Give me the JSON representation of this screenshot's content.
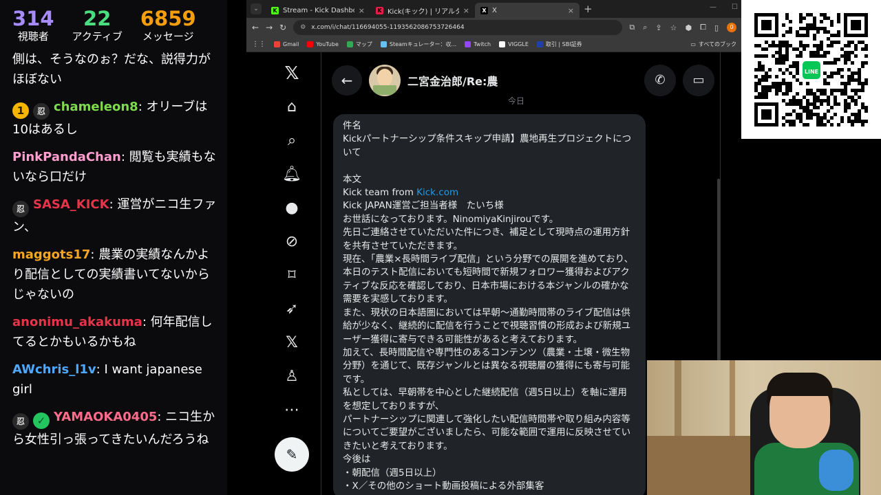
{
  "stream": {
    "stats": [
      {
        "value": "314",
        "label": "視聴者",
        "color": "#a78bfa"
      },
      {
        "value": "22",
        "label": "アクティブ",
        "color": "#4ade80"
      },
      {
        "value": "6859",
        "label": "メッセージ",
        "color": "#f59e0b"
      }
    ],
    "messages": [
      {
        "user": "",
        "text": "側は、そうなのぉ？だな、説得力がほぼない",
        "user_color": "#ffffff",
        "badges": []
      },
      {
        "user": "chameleon8",
        "text": "オリーブは10はあるし",
        "user_color": "#7ddc4e",
        "badges": [
          "1",
          "ninja"
        ]
      },
      {
        "user": "PinkPandaChan",
        "text": "閲覧も実績もないなら口だけ",
        "user_color": "#ff9ecf",
        "badges": []
      },
      {
        "user": "SASA_KICK",
        "text": "運営がニコ生ファン、",
        "user_color": "#e8344a",
        "badges": [
          "ninja"
        ]
      },
      {
        "user": "maggots17",
        "text": "農業の実績なんかより配信としての実績書いてないからじゃないの",
        "user_color": "#f5a524",
        "badges": []
      },
      {
        "user": "anonimu_akakuma",
        "text": "何年配信してるとかもいるかもね",
        "user_color": "#e8344a",
        "badges": []
      },
      {
        "user": "AWchris_l1v",
        "text": "I want japanese girl",
        "user_color": "#4ea8ff",
        "badges": []
      },
      {
        "user": "YAMAOKA0405",
        "text": "ニコ生から女性引っ張ってきたいんだろうね",
        "user_color": "#ff6b8a",
        "badges": [
          "ninja",
          "verified"
        ]
      }
    ]
  },
  "browser": {
    "tabs": [
      {
        "title": "Stream - Kick Dashboard",
        "fav_color": "#53fc18",
        "fav_text": "K",
        "active": false
      },
      {
        "title": "Kick(キック) | リアルタイムランキング",
        "fav_color": "#e11d48",
        "fav_text": "K",
        "active": false
      },
      {
        "title": "X",
        "fav_color": "#000000",
        "fav_text": "X",
        "active": true
      }
    ],
    "url": "x.com/i/chat/116694055-1193562086753726464",
    "bookmarks": [
      {
        "label": "Gmail",
        "color": "#ea4335"
      },
      {
        "label": "YouTube",
        "color": "#ff0000"
      },
      {
        "label": "マップ",
        "color": "#34a853"
      },
      {
        "label": "Steamキュレーター：収...",
        "color": "#66c0f4"
      },
      {
        "label": "Twitch",
        "color": "#9146ff"
      },
      {
        "label": "VIGGLE",
        "color": "#ffffff"
      },
      {
        "label": "取引 | SBI証券",
        "color": "#1e40af"
      }
    ],
    "bookmarks_right": "すべてのブック"
  },
  "dm": {
    "contact_name": "二宮金治郎/Re:農",
    "date_label": "今日",
    "body_lines": [
      "件名",
      "Kickパートナーシップ条件スキップ申請】農地再生プロジェクトについて",
      "",
      "本文",
      "__LINK__",
      "Kick JAPAN運営ご担当者様　たいち様",
      "お世話になっております。NinomiyaKinjirouです。",
      "先日ご連絡させていただいた件につき、補足として現時点の運用方針を共有させていただきます。",
      "現在、「農業×長時間ライブ配信」という分野での展開を進めており、本日のテスト配信においても短時間で新規フォロワー獲得およびアクティブな反応を確認しており、日本市場における本ジャンルの確かな需要を実感しております。",
      "また、現状の日本語圏においては早朝〜通勤時間帯のライブ配信は供給が少なく、継続的に配信を行うことで視聴習慣の形成および新規ユーザー獲得に寄与できる可能性があると考えております。",
      "加えて、長時間配信や専門性のあるコンテンツ（農業・土壌・微生物分野）を通じて、既存ジャンルとは異なる視聴層の獲得にも寄与可能です。",
      "私としては、早朝帯を中心とした継続配信（週5日以上）を軸に運用を想定しておりますが、",
      "パートナーシップに関連して強化したい配信時間帯や取り組み内容等についてご要望がございましたら、可能な範囲で運用に反映させていきたいと考えております。",
      "今後は",
      "・朝配信（週5日以上）",
      "・X／その他のショート動画投稿による外部集客"
    ],
    "link_prefix": "Kick team from ",
    "link_text": "Kick.com"
  },
  "qr": {
    "badge_label": "LINE"
  },
  "colors": {
    "x_bg": "#000000",
    "bubble_bg": "#202327",
    "link": "#1d9bf0"
  }
}
